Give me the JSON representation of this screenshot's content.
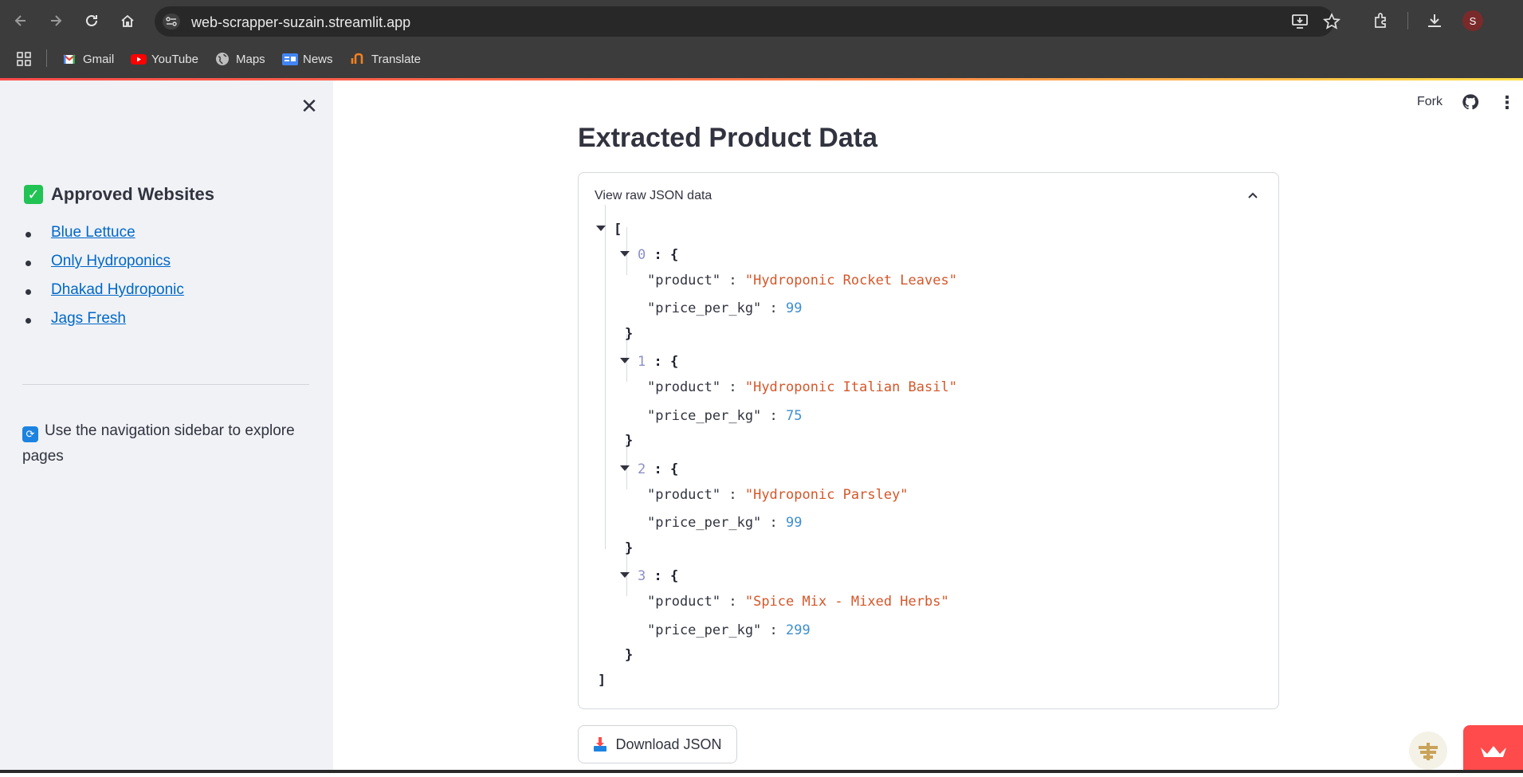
{
  "browser": {
    "url": "web-scrapper-suzain.streamlit.app",
    "profile_initial": "S",
    "bookmarks": [
      {
        "label": "Gmail",
        "icon": "gmail-icon",
        "color": "#ea4335"
      },
      {
        "label": "YouTube",
        "icon": "youtube-icon",
        "color": "#ff0000"
      },
      {
        "label": "Maps",
        "icon": "globe-icon",
        "color": "#bdbdbd"
      },
      {
        "label": "News",
        "icon": "news-icon",
        "color": "#4285f4"
      },
      {
        "label": "Translate",
        "icon": "translate-icon",
        "color": "#f4811f"
      }
    ]
  },
  "sidebar": {
    "heading": "Approved Websites",
    "links": [
      "Blue Lettuce",
      "Only Hydroponics",
      "Dhakad Hydroponic",
      "Jags Fresh"
    ],
    "info": "Use the navigation sidebar to explore pages"
  },
  "header": {
    "fork_label": "Fork"
  },
  "main": {
    "title": "Extracted Product Data",
    "expander_label": "View raw JSON data",
    "download_label": "Download JSON"
  },
  "json_data": [
    {
      "index": "0",
      "product_key": "\"product\"",
      "product": "\"Hydroponic Rocket Leaves\"",
      "price_key": "\"price_per_kg\"",
      "price": "99"
    },
    {
      "index": "1",
      "product_key": "\"product\"",
      "product": "\"Hydroponic Italian Basil\"",
      "price_key": "\"price_per_kg\"",
      "price": "75"
    },
    {
      "index": "2",
      "product_key": "\"product\"",
      "product": "\"Hydroponic Parsley\"",
      "price_key": "\"price_per_kg\"",
      "price": "99"
    },
    {
      "index": "3",
      "product_key": "\"product\"",
      "product": "\"Spice Mix - Mixed Herbs\"",
      "price_key": "\"price_per_kg\"",
      "price": "299"
    }
  ],
  "colors": {
    "accent": "#ff4b4b",
    "link": "#0068c9",
    "json_string": "#d4572a",
    "json_number": "#3f8fcf"
  }
}
